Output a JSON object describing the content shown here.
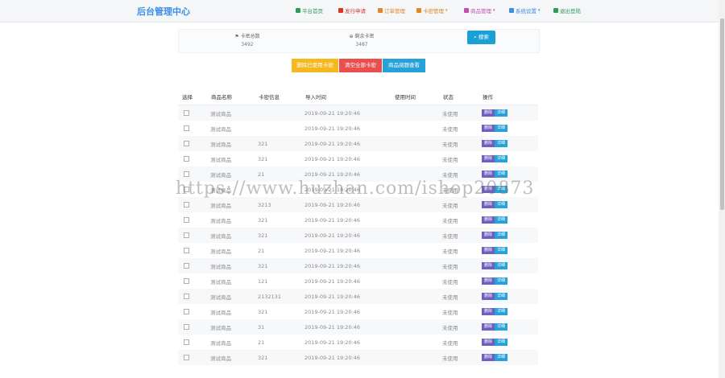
{
  "brand": "后台管理中心",
  "nav": [
    {
      "label": "平台首页",
      "color": "#2e9b5b",
      "dropdown": false,
      "icon": "user-icon"
    },
    {
      "label": "发行申请",
      "color": "#d9342b",
      "dropdown": false,
      "icon": "cloud-icon"
    },
    {
      "label": "订单管理",
      "color": "#e2862b",
      "dropdown": false,
      "icon": "list-icon"
    },
    {
      "label": "卡密管理",
      "color": "#e2862b",
      "dropdown": true,
      "icon": "card-icon"
    },
    {
      "label": "商品管理",
      "color": "#c14fb0",
      "dropdown": true,
      "icon": "box-icon"
    },
    {
      "label": "系统设置",
      "color": "#3a8ee6",
      "dropdown": true,
      "icon": "gear-icon"
    },
    {
      "label": "退出登陆",
      "color": "#2e9b5b",
      "dropdown": false,
      "icon": "logout-icon"
    }
  ],
  "stats": {
    "total_label": "卡密总数",
    "total_value": "3492",
    "remain_label": "剩余卡密",
    "remain_value": "3487"
  },
  "search_label": "搜索",
  "actions": [
    {
      "label": "删除已使用卡密",
      "color": "#f5b81f"
    },
    {
      "label": "清空全部卡密",
      "color": "#ea4f4f"
    },
    {
      "label": "商品阅题查看",
      "color": "#27a2d8"
    }
  ],
  "table": {
    "headers": [
      "选择",
      "商品名称",
      "卡密信息",
      "导入时间",
      "使用时间",
      "状态",
      "操作"
    ],
    "op_delete": "删除",
    "op_detail": "详细",
    "rows": [
      {
        "name": "测试商品",
        "info": "",
        "time": "2019-09-21 19:20:46",
        "used": "",
        "status": "未使用"
      },
      {
        "name": "测试商品",
        "info": "",
        "time": "2019-09-21 19:20:46",
        "used": "",
        "status": "未使用"
      },
      {
        "name": "测试商品",
        "info": "321",
        "time": "2019-09-21 19:20:46",
        "used": "",
        "status": "未使用"
      },
      {
        "name": "测试商品",
        "info": "321",
        "time": "2019-09-21 19:20:46",
        "used": "",
        "status": "未使用"
      },
      {
        "name": "测试商品",
        "info": "21",
        "time": "2019-09-21 19:20:46",
        "used": "",
        "status": "未使用"
      },
      {
        "name": "测试商品",
        "info": "",
        "time": "2019-09-21 19:20:46",
        "used": "",
        "status": "未使用"
      },
      {
        "name": "测试商品",
        "info": "3213",
        "time": "2019-09-21 19:20:46",
        "used": "",
        "status": "未使用"
      },
      {
        "name": "测试商品",
        "info": "321",
        "time": "2019-09-21 19:20:46",
        "used": "",
        "status": "未使用"
      },
      {
        "name": "测试商品",
        "info": "321",
        "time": "2019-09-21 19:20:46",
        "used": "",
        "status": "未使用"
      },
      {
        "name": "测试商品",
        "info": "21",
        "time": "2019-09-21 19:20:46",
        "used": "",
        "status": "未使用"
      },
      {
        "name": "测试商品",
        "info": "321",
        "time": "2019-09-21 19:20:46",
        "used": "",
        "status": "未使用"
      },
      {
        "name": "测试商品",
        "info": "121",
        "time": "2019-09-21 19:20:46",
        "used": "",
        "status": "未使用"
      },
      {
        "name": "测试商品",
        "info": "2132131",
        "time": "2019-09-21 19:20:46",
        "used": "",
        "status": "未使用"
      },
      {
        "name": "测试商品",
        "info": "321",
        "time": "2019-09-21 19:20:46",
        "used": "",
        "status": "未使用"
      },
      {
        "name": "测试商品",
        "info": "31",
        "time": "2019-09-21 19:20:46",
        "used": "",
        "status": "未使用"
      },
      {
        "name": "测试商品",
        "info": "21",
        "time": "2019-09-21 19:20:46",
        "used": "",
        "status": "未使用"
      },
      {
        "name": "测试商品",
        "info": "321",
        "time": "2019-09-21 19:20:46",
        "used": "",
        "status": "未使用"
      }
    ]
  },
  "watermark": "https://www.huzhan.com/ishop20873"
}
